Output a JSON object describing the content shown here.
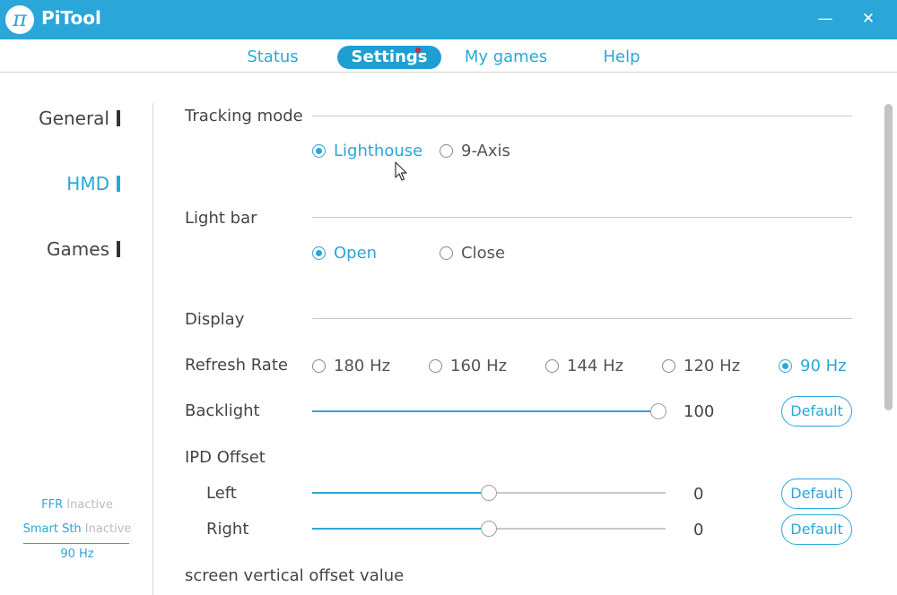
{
  "window": {
    "title": "PiTool",
    "logo_glyph": "π",
    "minimize_glyph": "—",
    "close_glyph": "✕"
  },
  "tabs": [
    {
      "label": "Status",
      "active": false
    },
    {
      "label": "Settings",
      "active": true
    },
    {
      "label": "My games",
      "active": false
    },
    {
      "label": "Help",
      "active": false
    }
  ],
  "sidebar": {
    "items": [
      {
        "label": "General",
        "active": false
      },
      {
        "label": "HMD",
        "active": true
      },
      {
        "label": "Games",
        "active": false
      }
    ]
  },
  "status": {
    "ffr_label": "FFR",
    "ffr_value": "Inactive",
    "smart_label": "Smart Sth",
    "smart_value": "Inactive",
    "refresh": "90 Hz"
  },
  "settings": {
    "tracking_mode": {
      "label": "Tracking mode",
      "options": [
        "Lighthouse",
        "9-Axis"
      ],
      "selected": "Lighthouse"
    },
    "light_bar": {
      "label": "Light bar",
      "options": [
        "Open",
        "Close"
      ],
      "selected": "Open"
    },
    "display": {
      "label": "Display"
    },
    "refresh_rate": {
      "label": "Refresh Rate",
      "options": [
        "180 Hz",
        "160 Hz",
        "144 Hz",
        "120 Hz",
        "90 Hz"
      ],
      "selected": "90 Hz"
    },
    "backlight": {
      "label": "Backlight",
      "value": "100",
      "level_percent": 100,
      "default_label": "Default"
    },
    "ipd_offset": {
      "label": "IPD Offset",
      "left": {
        "label": "Left",
        "value": "0",
        "level_percent": 50,
        "default_label": "Default"
      },
      "right": {
        "label": "Right",
        "value": "0",
        "level_percent": 50,
        "default_label": "Default"
      }
    },
    "screen_vertical_offset": {
      "label": "screen vertical offset value"
    }
  },
  "colors": {
    "accent": "#2aa7d8",
    "titlebar": "#2aa7d8",
    "notification_dot": "#e0203a"
  }
}
